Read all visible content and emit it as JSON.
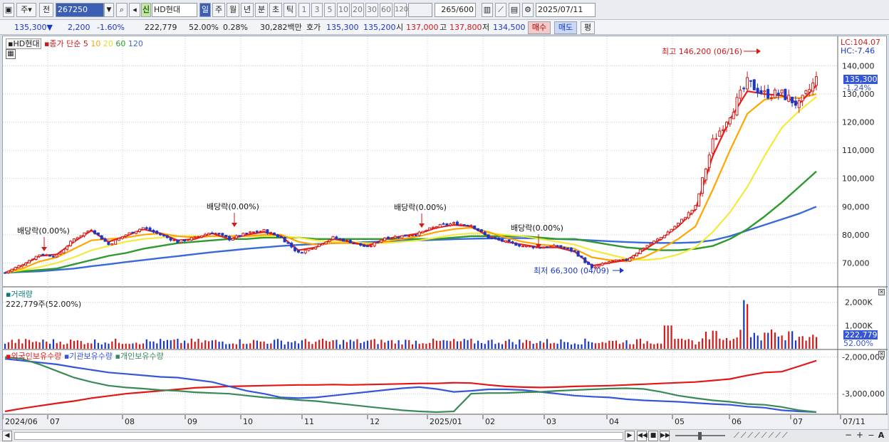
{
  "toolbar": {
    "mode": "주",
    "prev": "전",
    "code": "267250",
    "new_badge": "신",
    "stock_name": "HD현대",
    "periods": [
      "일",
      "주",
      "월",
      "년",
      "분",
      "초",
      "틱"
    ],
    "ticks": [
      "1",
      "3",
      "5",
      "10",
      "20",
      "30",
      "60",
      "120"
    ],
    "count": "265",
    "count_total": "/600",
    "date": "2025/07/11"
  },
  "quote": {
    "price": "135,300",
    "dir": "▼",
    "change": "2,200",
    "change_pct": "-1.60%",
    "volume": "222,779",
    "vol_ratio": "52.00%",
    "turnover": "0.28%",
    "amount": "30,282백만",
    "hoga_label": "호가",
    "ask": "135,300",
    "bid": "135,200",
    "open_label": "시",
    "open": "137,000",
    "high_label": "고",
    "high": "137,800",
    "low_label": "저",
    "low": "134,500",
    "buy": "매수",
    "sell": "매도",
    "eval": "평"
  },
  "legend": {
    "name": "HD현대",
    "ma_label": "종가 단순",
    "ma": [
      {
        "n": "5",
        "color": "#e8201c"
      },
      {
        "n": "10",
        "color": "#ffa500"
      },
      {
        "n": "20",
        "color": "#f2ea3c"
      },
      {
        "n": "60",
        "color": "#2e9a2e"
      },
      {
        "n": "120",
        "color": "#3a6ad8"
      }
    ]
  },
  "lc": "LC:104.07",
  "hc": "HC:-7.46",
  "annotations": {
    "high": "최고 146,200 (06/16)",
    "low": "최저 66,300 (04/09)",
    "dividend": "배당락(0.00%)"
  },
  "price_panel": {
    "current": "135,300",
    "current_pct": "-1.24%"
  },
  "volume_panel": {
    "title": "거래량",
    "info": "222,779주(52.00%)",
    "current": "222,779",
    "current_pct": "52.00%"
  },
  "holdings_panel": {
    "items": [
      "외국인보유수량",
      "기관보유수량",
      "개인보유수량"
    ]
  },
  "colors": {
    "up": "#d11a1a",
    "down": "#1a38c8",
    "ma5": "#e8201c",
    "ma10": "#ffa500",
    "ma20": "#f2ea3c",
    "ma60": "#2e9a2e",
    "ma120": "#3a6ad8",
    "foreign": "#e01818",
    "inst": "#3556d8",
    "indiv": "#3a8a58"
  },
  "chart_data": {
    "type": "line",
    "subtype": "candlestick",
    "period": "daily",
    "y_price_ticks": [
      70000,
      80000,
      90000,
      100000,
      110000,
      120000,
      130000,
      140000
    ],
    "y_volume_ticks": [
      1000,
      2000
    ],
    "y_volume_unit": "K",
    "y_holdings_ticks": [
      -3000000,
      -2000000
    ],
    "x_tick_labels": [
      "2024/06",
      "07",
      "08",
      "09",
      "10",
      "11",
      "12",
      "2025/01",
      "02",
      "03",
      "04",
      "05",
      "06",
      "07",
      "07/11"
    ],
    "close_weekly": [
      {
        "x": "2024/06",
        "y": 66500
      },
      {
        "x": "06",
        "y": 69500
      },
      {
        "x": "07",
        "y": 73000
      },
      {
        "x": "07",
        "y": 72500
      },
      {
        "x": "07",
        "y": 78500
      },
      {
        "x": "07",
        "y": 82000
      },
      {
        "x": "08",
        "y": 76500
      },
      {
        "x": "08",
        "y": 80000
      },
      {
        "x": "08",
        "y": 82500
      },
      {
        "x": "08",
        "y": 80000
      },
      {
        "x": "09",
        "y": 77500
      },
      {
        "x": "09",
        "y": 79000
      },
      {
        "x": "09",
        "y": 81000
      },
      {
        "x": "10",
        "y": 78500
      },
      {
        "x": "10",
        "y": 80500
      },
      {
        "x": "10",
        "y": 81500
      },
      {
        "x": "10",
        "y": 79000
      },
      {
        "x": "11",
        "y": 73500
      },
      {
        "x": "11",
        "y": 76000
      },
      {
        "x": "11",
        "y": 79000
      },
      {
        "x": "12",
        "y": 77500
      },
      {
        "x": "12",
        "y": 75500
      },
      {
        "x": "12",
        "y": 79000
      },
      {
        "x": "12",
        "y": 79500
      },
      {
        "x": "2025/01",
        "y": 80500
      },
      {
        "x": "01",
        "y": 83000
      },
      {
        "x": "01",
        "y": 84000
      },
      {
        "x": "02",
        "y": 83500
      },
      {
        "x": "02",
        "y": 79000
      },
      {
        "x": "02",
        "y": 77500
      },
      {
        "x": "03",
        "y": 76000
      },
      {
        "x": "03",
        "y": 75500
      },
      {
        "x": "03",
        "y": 76000
      },
      {
        "x": "03",
        "y": 74000
      },
      {
        "x": "04",
        "y": 68000
      },
      {
        "x": "04",
        "y": 70500
      },
      {
        "x": "04",
        "y": 71000
      },
      {
        "x": "05",
        "y": 75500
      },
      {
        "x": "05",
        "y": 79000
      },
      {
        "x": "05",
        "y": 84000
      },
      {
        "x": "05",
        "y": 90000
      },
      {
        "x": "05",
        "y": 113000
      },
      {
        "x": "06",
        "y": 123000
      },
      {
        "x": "06",
        "y": 134000
      },
      {
        "x": "06",
        "y": 130000
      },
      {
        "x": "06",
        "y": 130000
      },
      {
        "x": "07",
        "y": 126000
      },
      {
        "x": "07",
        "y": 135300
      }
    ],
    "series": [
      {
        "name": "5",
        "values": [
          66500,
          69000,
          72500,
          73000,
          77500,
          81500,
          77500,
          79500,
          82000,
          80500,
          78000,
          78500,
          80500,
          78500,
          80000,
          81000,
          79500,
          74500,
          75500,
          78500,
          77500,
          76000,
          78500,
          79500,
          80500,
          82500,
          83500,
          83000,
          79500,
          77500,
          76500,
          75500,
          75500,
          74000,
          69000,
          70000,
          71000,
          74500,
          78500,
          83000,
          89000,
          108000,
          121000,
          131000,
          130000,
          129500,
          126500,
          133000
        ]
      },
      {
        "name": "10",
        "values": [
          66500,
          68000,
          70500,
          72000,
          75000,
          78000,
          78500,
          79000,
          80000,
          80500,
          79500,
          79000,
          79500,
          79500,
          79500,
          80000,
          80000,
          77500,
          76500,
          77000,
          77000,
          76500,
          77500,
          78500,
          79500,
          81000,
          82000,
          82500,
          81000,
          79000,
          77500,
          76500,
          76000,
          75000,
          72000,
          71000,
          70500,
          72000,
          75000,
          78500,
          83000,
          96000,
          110000,
          123000,
          128000,
          129000,
          128500,
          130000
        ]
      },
      {
        "name": "20",
        "values": [
          66500,
          67500,
          68500,
          70000,
          72000,
          74500,
          76000,
          77500,
          78500,
          79000,
          79500,
          79500,
          79500,
          79500,
          79500,
          79500,
          79500,
          79000,
          78000,
          77500,
          77500,
          77000,
          77000,
          77500,
          78000,
          79000,
          80000,
          80500,
          80500,
          80000,
          79500,
          78500,
          77500,
          76500,
          74500,
          73000,
          71500,
          71000,
          71500,
          73000,
          75500,
          81000,
          88000,
          97000,
          108000,
          118000,
          124000,
          129000
        ]
      },
      {
        "name": "60",
        "values": [
          66500,
          67000,
          67500,
          68000,
          69500,
          71000,
          72500,
          73500,
          75000,
          76000,
          77000,
          77500,
          78000,
          78500,
          78500,
          79000,
          79000,
          79000,
          78500,
          78500,
          78500,
          78500,
          78500,
          78500,
          78500,
          78500,
          79000,
          79500,
          79500,
          79500,
          79500,
          79000,
          78500,
          78500,
          77500,
          76500,
          75500,
          75000,
          74500,
          74500,
          75000,
          76000,
          78500,
          82000,
          86500,
          91500,
          97000,
          102500
        ]
      },
      {
        "name": "120",
        "values": [
          66500,
          66800,
          67000,
          67500,
          68000,
          68800,
          69500,
          70300,
          71000,
          71700,
          72400,
          73100,
          73800,
          74400,
          75000,
          75500,
          76000,
          76400,
          76700,
          77000,
          77200,
          77400,
          77600,
          77800,
          78000,
          78200,
          78400,
          78600,
          78700,
          78800,
          78800,
          78700,
          78500,
          78300,
          78000,
          77700,
          77400,
          77200,
          77100,
          77100,
          77300,
          78000,
          79500,
          81500,
          83500,
          85500,
          87500,
          90000
        ]
      }
    ],
    "volume_note": "daily volume bars, red up / blue down, peak near 2,200K in 06"
  }
}
